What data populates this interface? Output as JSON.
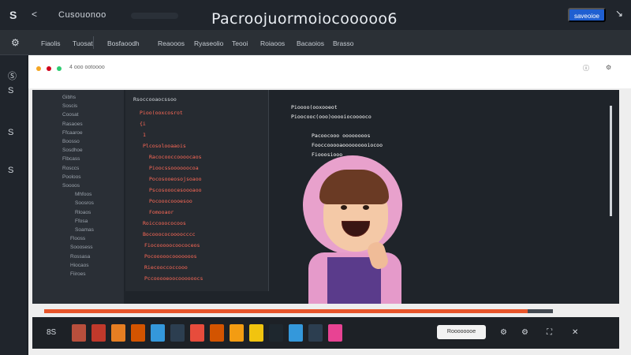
{
  "header": {
    "logo_glyph": "S",
    "caret": "<",
    "brand": "Cusouonoo",
    "title": "Pacroojuormoiocooooo6",
    "primary_button": "saveoioe",
    "cursor": "↘"
  },
  "menu": {
    "home_icon": "gear-icon",
    "items": [
      "Fiaolis",
      "Tuosat",
      "Bosfaoodh",
      "Reaooos",
      "Ryaseolio",
      "Teooi",
      "Roiaoos",
      "Bacaoios",
      "Brasso"
    ]
  },
  "left_rail": {
    "icons": [
      "Ⓢ",
      "S",
      "S",
      "S"
    ]
  },
  "browser": {
    "address_text": "4 ooo ootoooo",
    "icons": [
      "info-icon",
      "settings-icon"
    ]
  },
  "file_tree": {
    "items": [
      "Gibhs",
      "Soscis",
      "Coosat",
      "Rasaoes",
      "Ffcaaroe",
      "Boosso",
      "Sosdhoe",
      "Flbcass",
      "Rosccs",
      "Pooloos",
      "Soooos",
      "Mhfoos",
      "Soosros",
      "Rloaos",
      "Ffosa",
      "Soamas",
      "Flooss",
      "Sooosess",
      "Rossasa",
      "Hiocaos",
      "Fiiroes"
    ]
  },
  "editor": {
    "tab": "Rsoccooaocssoo",
    "lines": [
      {
        "text": "Pioo(ooxcosrot",
        "color": "#ff6a57"
      },
      {
        "text": "{i",
        "color": "#ff6a57"
      },
      {
        "text": "1",
        "color": "#ff6a57"
      },
      {
        "text": "Plcosolooaaois",
        "color": "#ff6a57"
      },
      {
        "text": "Racocooccoooocaos",
        "color": "#ff6a57"
      },
      {
        "text": "Pioocssoooooocoa",
        "color": "#ff6a57"
      },
      {
        "text": "Pocosooeosojsoaoo",
        "color": "#ff6a57"
      },
      {
        "text": "Pscosooocesoooaoo",
        "color": "#ff6a57"
      },
      {
        "text": "Pocooocoooesoo",
        "color": "#ff6a57"
      },
      {
        "text": "Fomooaor",
        "color": "#ff6a57"
      },
      {
        "text": "Roiccooococoos",
        "color": "#ff6a57"
      },
      {
        "text": "Bocooococoooocccc",
        "color": "#ff6a57"
      },
      {
        "text": "Fiocooooocoococeos",
        "color": "#ff6a57"
      },
      {
        "text": "Pocooooocooooooos",
        "color": "#ff6a57"
      },
      {
        "text": "Riecooccoccooo",
        "color": "#ff6a57"
      },
      {
        "text": "Pccooooeoocoooooocs",
        "color": "#ff6a57"
      }
    ]
  },
  "console": {
    "lines": [
      {
        "text": "Pioooo(ooxooeot",
        "color": "#ffffff"
      },
      {
        "text": "Pioocooc(ooo)ooooiocooooco",
        "color": "#ffffff"
      },
      {
        "text": "Pacoocooo oooooooos",
        "color": "#ffffff"
      },
      {
        "text": "Fooccooooaooooooooiocoo",
        "color": "#ffffff"
      },
      {
        "text": "Fiooosiooo",
        "color": "#ffffff"
      }
    ]
  },
  "controls": {
    "progress": 0.95,
    "left_label": "8S",
    "quality": "Roooooooe",
    "right_icons": [
      "gear-icon",
      "settings-icon",
      "fullscreen-icon",
      "close-icon"
    ],
    "thumbs": [
      {
        "color": "#b84f3c"
      },
      {
        "color": "#c0392b"
      },
      {
        "color": "#e67e22"
      },
      {
        "color": "#d35400"
      },
      {
        "color": "#3498db"
      },
      {
        "color": "#2c3e50"
      },
      {
        "color": "#e74c3c"
      },
      {
        "color": "#d35400"
      },
      {
        "color": "#f39c12"
      },
      {
        "color": "#f1c40f"
      },
      {
        "color": "#1e272e"
      },
      {
        "color": "#3498db"
      },
      {
        "color": "#2c3e50"
      },
      {
        "color": "#e84393"
      }
    ]
  }
}
